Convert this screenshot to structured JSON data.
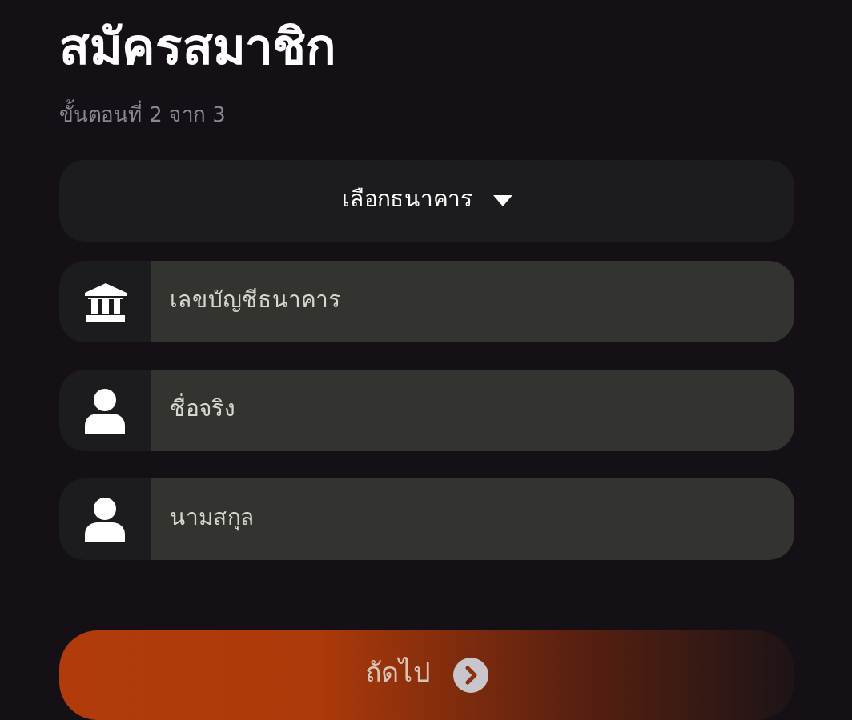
{
  "title": "สมัครสมาชิก",
  "step": "ขั้นตอนที่ 2 จาก 3",
  "bank_select": {
    "label": "เลือกธนาคาร"
  },
  "fields": [
    {
      "kind": "account",
      "placeholder": "เลขบัญชีธนาคาร"
    },
    {
      "kind": "name",
      "placeholder": "ชื่อจริง"
    },
    {
      "kind": "name",
      "placeholder": "นามสกุล"
    }
  ],
  "next_button": {
    "label": "ถัดไป"
  }
}
